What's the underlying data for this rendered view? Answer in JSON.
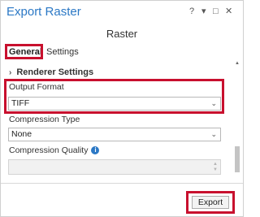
{
  "window": {
    "title": "Export Raster",
    "help_glyph": "?",
    "menu_glyph": "▾",
    "restore_glyph": "□",
    "close_glyph": "✕"
  },
  "pane": {
    "subtitle": "Raster"
  },
  "tabs": [
    {
      "label": "General",
      "selected": true
    },
    {
      "label": "Settings",
      "selected": false
    }
  ],
  "section": {
    "label": "Renderer Settings",
    "chevron": "›"
  },
  "fields": {
    "output_format": {
      "label": "Output Format",
      "value": "TIFF",
      "arrow": "⌄"
    },
    "compression_type": {
      "label": "Compression Type",
      "value": "None",
      "arrow": "⌄"
    },
    "compression_quality": {
      "label": "Compression Quality",
      "value": "",
      "info_glyph": "i",
      "spin_up": "▲",
      "spin_down": "▼"
    }
  },
  "scrollbar": {
    "up_glyph": "▲"
  },
  "footer": {
    "export_label": "Export"
  },
  "colors": {
    "accent": "#2b78c5",
    "highlight": "#c8102e"
  }
}
